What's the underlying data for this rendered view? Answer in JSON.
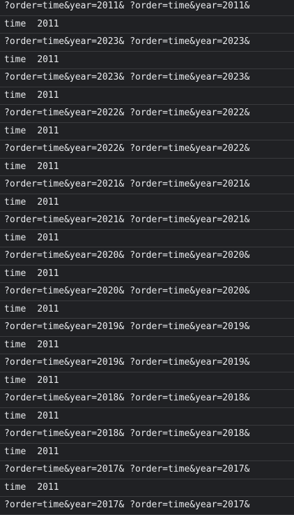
{
  "console": {
    "lines": [
      {
        "type": "url",
        "a": "?order=time&year=2011&",
        "b": "?order=time&year=2011&"
      },
      {
        "type": "log",
        "a": "time",
        "b": "2011"
      },
      {
        "type": "url",
        "a": "?order=time&year=2023&",
        "b": "?order=time&year=2023&"
      },
      {
        "type": "log",
        "a": "time",
        "b": "2011"
      },
      {
        "type": "url",
        "a": "?order=time&year=2023&",
        "b": "?order=time&year=2023&"
      },
      {
        "type": "log",
        "a": "time",
        "b": "2011"
      },
      {
        "type": "url",
        "a": "?order=time&year=2022&",
        "b": "?order=time&year=2022&"
      },
      {
        "type": "log",
        "a": "time",
        "b": "2011"
      },
      {
        "type": "url",
        "a": "?order=time&year=2022&",
        "b": "?order=time&year=2022&"
      },
      {
        "type": "log",
        "a": "time",
        "b": "2011"
      },
      {
        "type": "url",
        "a": "?order=time&year=2021&",
        "b": "?order=time&year=2021&"
      },
      {
        "type": "log",
        "a": "time",
        "b": "2011"
      },
      {
        "type": "url",
        "a": "?order=time&year=2021&",
        "b": "?order=time&year=2021&"
      },
      {
        "type": "log",
        "a": "time",
        "b": "2011"
      },
      {
        "type": "url",
        "a": "?order=time&year=2020&",
        "b": "?order=time&year=2020&"
      },
      {
        "type": "log",
        "a": "time",
        "b": "2011"
      },
      {
        "type": "url",
        "a": "?order=time&year=2020&",
        "b": "?order=time&year=2020&"
      },
      {
        "type": "log",
        "a": "time",
        "b": "2011"
      },
      {
        "type": "url",
        "a": "?order=time&year=2019&",
        "b": "?order=time&year=2019&"
      },
      {
        "type": "log",
        "a": "time",
        "b": "2011"
      },
      {
        "type": "url",
        "a": "?order=time&year=2019&",
        "b": "?order=time&year=2019&"
      },
      {
        "type": "log",
        "a": "time",
        "b": "2011"
      },
      {
        "type": "url",
        "a": "?order=time&year=2018&",
        "b": "?order=time&year=2018&"
      },
      {
        "type": "log",
        "a": "time",
        "b": "2011"
      },
      {
        "type": "url",
        "a": "?order=time&year=2018&",
        "b": "?order=time&year=2018&"
      },
      {
        "type": "log",
        "a": "time",
        "b": "2011"
      },
      {
        "type": "url",
        "a": "?order=time&year=2017&",
        "b": "?order=time&year=2017&"
      },
      {
        "type": "log",
        "a": "time",
        "b": "2011"
      },
      {
        "type": "url",
        "a": "?order=time&year=2017&",
        "b": "?order=time&year=2017&"
      }
    ]
  },
  "colors": {
    "background": "#202124",
    "text": "#e8eaed",
    "divider": "#3a3b3e"
  }
}
